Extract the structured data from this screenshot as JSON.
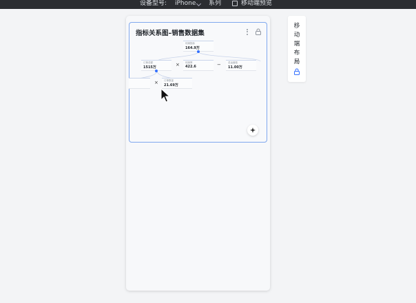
{
  "topbar": {
    "device_type_label": "设备型号:",
    "device_value": "iPhone",
    "series_label": "系列",
    "preview_label": "移动端预览"
  },
  "card": {
    "title": "指标关系图–销售数据集",
    "nodes": [
      {
        "label": "利润指标",
        "value": "164.9万"
      },
      {
        "label": "订单总额",
        "value": "1515万"
      },
      {
        "label": "利润率",
        "value": "422.6"
      },
      {
        "label": "总运营费",
        "value": "11.00万"
      },
      {
        "label": "",
        "value": ""
      },
      {
        "label": "订单数量",
        "value": "21.69万"
      }
    ],
    "operators": [
      "×",
      "−",
      "×"
    ]
  },
  "side_panel": {
    "chars": [
      "移",
      "动",
      "端",
      "布",
      "局"
    ]
  },
  "icons": {
    "more": "more-vertical-icon",
    "lock": "lock-icon",
    "ai": "sparkle-icon",
    "mobile": "mobile-icon",
    "cursor": "mouse-cursor-icon"
  },
  "colors": {
    "accent": "#3370ff",
    "card_border": "#7fa7ee",
    "topbar_bg": "#2b2d31"
  }
}
